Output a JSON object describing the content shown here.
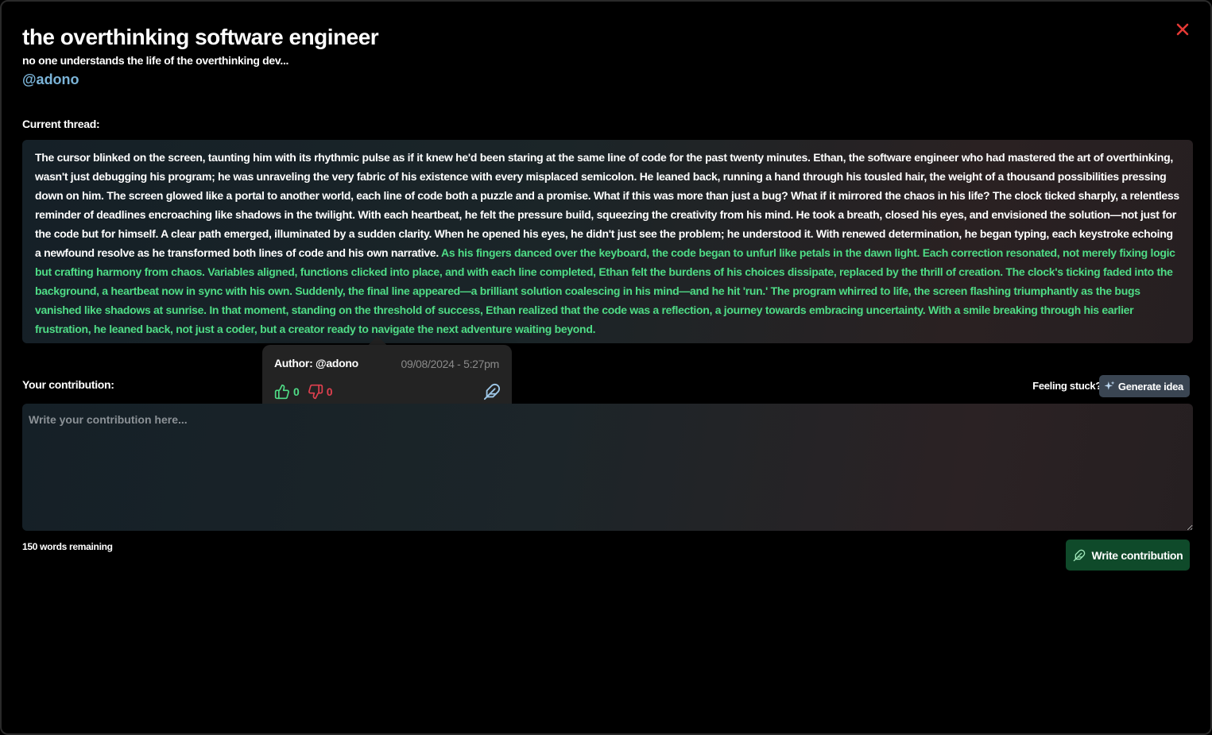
{
  "header": {
    "title": "the overthinking software engineer",
    "subtitle": "no one understands the life of the overthinking dev...",
    "handle": "@adono"
  },
  "thread": {
    "label": "Current thread:",
    "segments": [
      {
        "text": "The cursor blinked on the screen, taunting him with its rhythmic pulse as if it knew he'd been staring at the same line of code for the past twenty minutes. Ethan, the software engineer who had mastered the art of overthinking, wasn't just debugging his program; he was unraveling the very fabric of his existence with every misplaced semicolon. He leaned back, running a hand through his tousled hair, the weight of a thousand possibilities pressing down on him. The screen glowed like a portal to another world, each line of code both a puzzle and a promise. What if this was more than just a bug? What if it mirrored the chaos in his life? The clock ticked sharply, a relentless reminder of deadlines encroaching like shadows in the twilight. With each heartbeat, he felt the pressure build, squeezing the creativity from his mind. He took a breath, closed his eyes, and envisioned the solution—not just for the code but for himself. A clear path emerged, illuminated by a sudden clarity. When he opened his eyes, he didn't just see the problem; he understood it. With renewed determination, he began typing, each keystroke echoing a newfound resolve as he transformed both lines of code and his own narrative. "
      },
      {
        "text": "As his fingers danced over the keyboard, the code began to unfurl like petals in the dawn light. Each correction resonated, not merely fixing logic but crafting harmony from chaos. Variables aligned, functions clicked into place, and with each line completed, Ethan felt the burdens of his choices dissipate, replaced by the thrill of creation. The clock's ticking faded into the background, a heartbeat now in sync with his own. Suddenly, the final line appeared—a brilliant solution coalescing in his mind—and he hit 'run.' The program whirred to life, the screen flashing triumphantly as the bugs vanished like shadows at sunrise. In that moment, standing on the threshold of success, Ethan realized that the code was a reflection, a journey towards embracing uncertainty. With a smile breaking through his earlier frustration, he leaned back, not just a coder, but a creator ready to navigate the next adventure waiting beyond."
      }
    ]
  },
  "tooltip": {
    "author": "Author: @adono",
    "date": "09/08/2024 - 5:27pm",
    "upvotes": "0",
    "downvotes": "0"
  },
  "contribution": {
    "label": "Your contribution:",
    "placeholder": "Write your contribution here...",
    "words_remaining": "150 words remaining",
    "feeling_stuck": "Feeling stuck?",
    "generate_label": "Generate idea",
    "write_label": "Write contribution"
  },
  "colors": {
    "accent_green": "#4fdc86",
    "downvote_red": "#e0404f",
    "handle_blue": "#7bb4d8",
    "close_red": "#e53935",
    "write_button_bg": "#0f4a2a"
  },
  "icons": {
    "close": "close-icon",
    "upvote": "thumbs-up-icon",
    "downvote": "thumbs-down-icon",
    "feather": "feather-icon",
    "sparkle": "sparkle-icon"
  }
}
